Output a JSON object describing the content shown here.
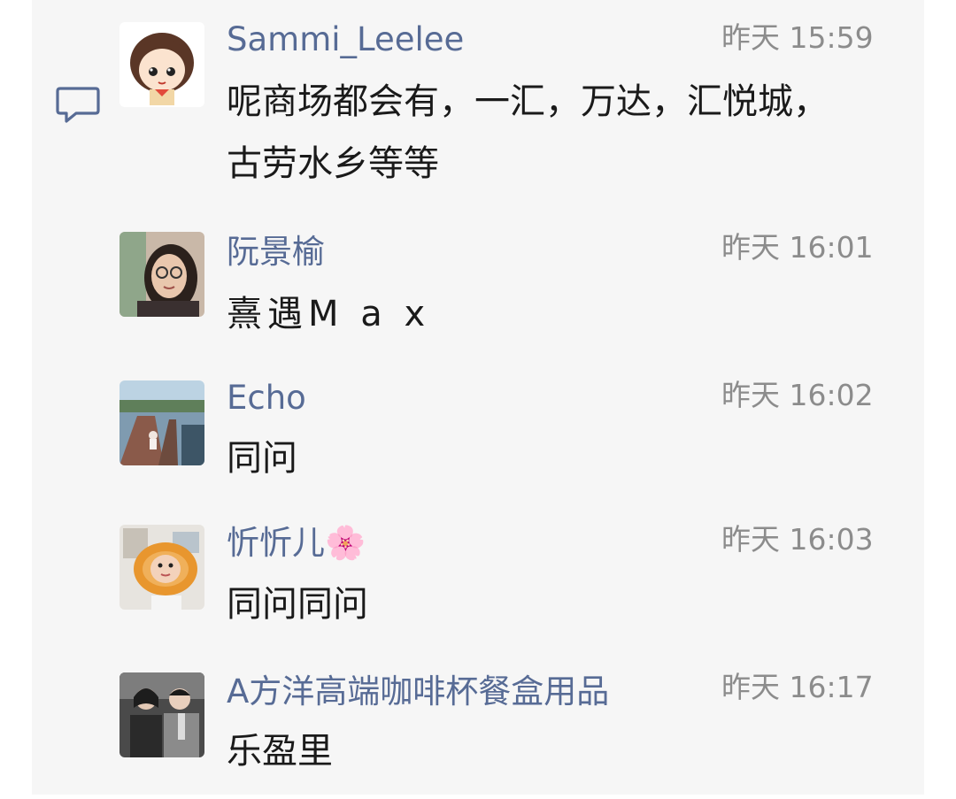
{
  "comments": [
    {
      "name": "Sammi_Leelee",
      "time": "昨天 15:59",
      "text": "呢商场都会有，一汇，万达，汇悦城，古劳水乡等等",
      "avatar": "cartoon-girl-avatar"
    },
    {
      "name": "阮景榆",
      "time": "昨天 16:01",
      "text": "熹遇M a x",
      "avatar": "woman-glasses-avatar"
    },
    {
      "name": "Echo",
      "time": "昨天 16:02",
      "text": "同问",
      "avatar": "pier-landscape-avatar"
    },
    {
      "name": "忻忻儿🌸",
      "time": "昨天 16:03",
      "text": "同问同问",
      "avatar": "donut-face-avatar"
    },
    {
      "name": "A方洋高端咖啡杯餐盒用品",
      "time": "昨天 16:17",
      "text": "乐盈里",
      "avatar": "couple-photo-avatar"
    }
  ],
  "colors": {
    "name": "#576b95",
    "time": "#8c8c8c",
    "text": "#1a1a1a",
    "panel": "#f6f6f6"
  },
  "icons": {
    "comment_section": "comment-bubble-icon"
  }
}
